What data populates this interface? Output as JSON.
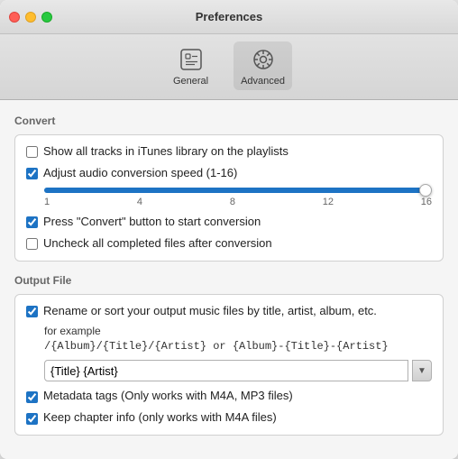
{
  "window": {
    "title": "Preferences"
  },
  "toolbar": {
    "items": [
      {
        "id": "general",
        "label": "General",
        "active": false
      },
      {
        "id": "advanced",
        "label": "Advanced",
        "active": true
      }
    ]
  },
  "convert_section": {
    "title": "Convert",
    "options": [
      {
        "id": "show-all-tracks",
        "label": "Show all tracks in iTunes library on the playlists",
        "checked": false
      },
      {
        "id": "adjust-audio",
        "label": "Adjust audio conversion speed (1-16)",
        "checked": true
      },
      {
        "id": "press-convert",
        "label": "Press \"Convert\" button to start conversion",
        "checked": true
      },
      {
        "id": "uncheck-completed",
        "label": "Uncheck all completed files after conversion",
        "checked": false
      }
    ],
    "slider": {
      "min": 1,
      "max": 16,
      "value": 16,
      "labels": [
        "1",
        "4",
        "8",
        "12",
        "16"
      ]
    }
  },
  "output_section": {
    "title": "Output File",
    "rename_option": {
      "id": "rename-sort",
      "label": "Rename or sort your output music files by title, artist, album, etc.",
      "checked": true
    },
    "example_label": "for example",
    "example_code": "/{Album}/{Title}/{Artist} or {Album}-{Title}-{Artist}",
    "input_value": "{Title} {Artist}",
    "metadata_option": {
      "id": "metadata-tags",
      "label": "Metadata tags (Only works with M4A, MP3 files)",
      "checked": true
    },
    "chapter_option": {
      "id": "keep-chapter",
      "label": "Keep chapter info (only works with  M4A files)",
      "checked": true
    }
  }
}
